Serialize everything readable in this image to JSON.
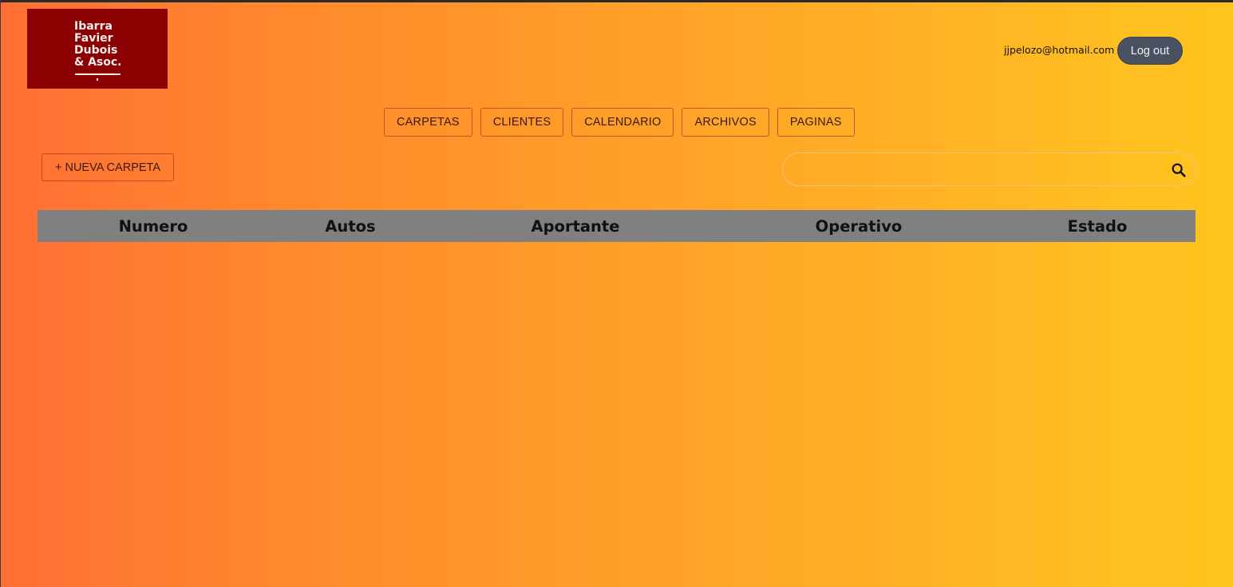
{
  "logo": {
    "lines": [
      "Ibarra",
      "Favier",
      "Dubois",
      "& Asoc."
    ],
    "background_color": "#8b0000"
  },
  "user": {
    "email": "jjpelozo@hotmail.com",
    "logout_label": "Log out"
  },
  "nav": {
    "items": [
      {
        "label": "CARPETAS"
      },
      {
        "label": "CLIENTES"
      },
      {
        "label": "CALENDARIO"
      },
      {
        "label": "ARCHIVOS"
      },
      {
        "label": "PAGINAS"
      }
    ]
  },
  "toolbar": {
    "new_folder_label": "+ NUEVA CARPETA",
    "search_placeholder": "",
    "search_icon": "search-icon"
  },
  "table": {
    "columns": [
      "Numero",
      "Autos",
      "Aportante",
      "Operativo",
      "Estado"
    ],
    "header_color": "#808080",
    "rows": []
  },
  "colors": {
    "gradient_start": "#ff6f35",
    "gradient_end": "#ffc51f",
    "logout_button": "#4a5160"
  }
}
